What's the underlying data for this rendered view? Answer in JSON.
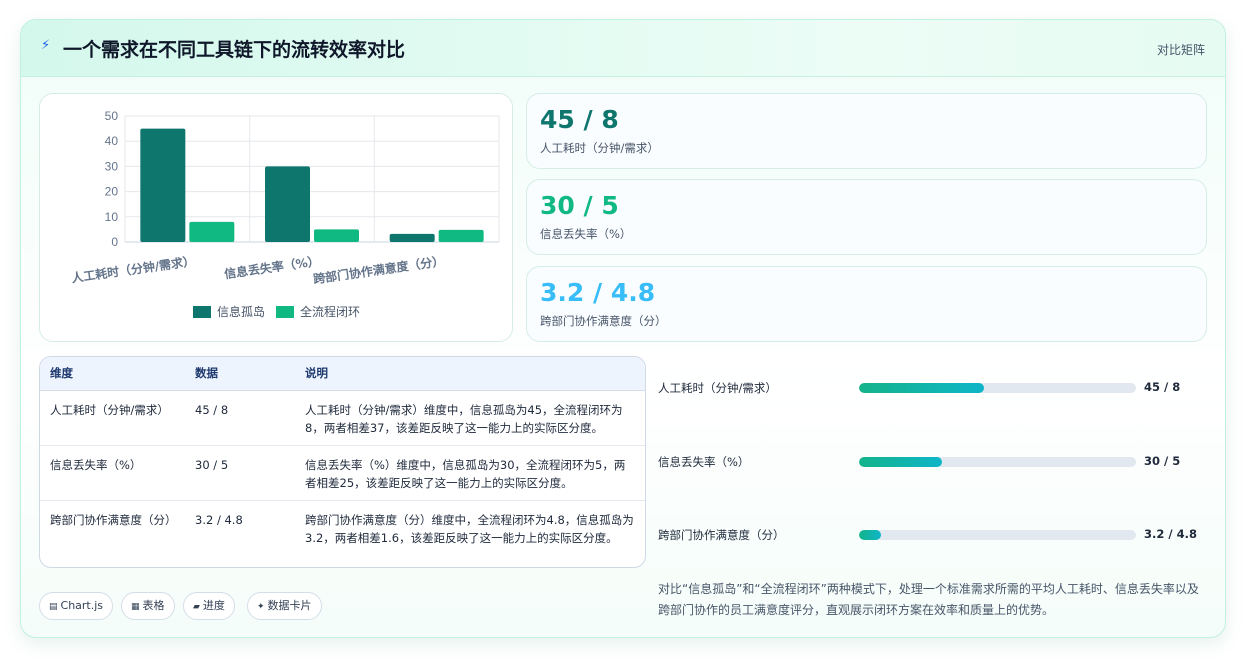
{
  "header": {
    "icon": "bolt-icon",
    "title": "一个需求在不同工具链下的流转效率对比",
    "tag": "对比矩阵"
  },
  "chart_data": {
    "type": "bar",
    "categories": [
      "人工耗时（分钟/需求）",
      "信息丢失率（%）",
      "跨部门协作满意度（分）"
    ],
    "series": [
      {
        "name": "信息孤岛",
        "values": [
          45,
          30,
          3.2
        ],
        "color": "#0f766e"
      },
      {
        "name": "全流程闭环",
        "values": [
          8,
          5,
          4.8
        ],
        "color": "#10b981"
      }
    ],
    "ylim": [
      0,
      50
    ],
    "yticks": [
      "0",
      "10",
      "20",
      "30",
      "40",
      "50"
    ],
    "grid": true,
    "legend_position": "bottom"
  },
  "stats": [
    {
      "value": "45 / 8",
      "label": "人工耗时（分钟/需求）",
      "color": "#0f766e"
    },
    {
      "value": "30 / 5",
      "label": "信息丢失率（%）",
      "color": "#10b981"
    },
    {
      "value": "3.2 / 4.8",
      "label": "跨部门协作满意度（分）",
      "color": "#38bdf8"
    }
  ],
  "table": {
    "headers": [
      "维度",
      "数据",
      "说明"
    ],
    "rows": [
      [
        "人工耗时（分钟/需求）",
        "45 / 8",
        "人工耗时（分钟/需求）维度中，信息孤岛为45，全流程闭环为8，两者相差37，该差距反映了这一能力上的实际区分度。"
      ],
      [
        "信息丢失率（%）",
        "30 / 5",
        "信息丢失率（%）维度中，信息孤岛为30，全流程闭环为5，两者相差25，该差距反映了这一能力上的实际区分度。"
      ],
      [
        "跨部门协作满意度（分）",
        "3.2 / 4.8",
        "跨部门协作满意度（分）维度中，全流程闭环为4.8，信息孤岛为3.2，两者相差1.6，该差距反映了这一能力上的实际区分度。"
      ]
    ]
  },
  "progress": [
    {
      "label": "人工耗时（分钟/需求）",
      "value": "45 / 8",
      "fill_fraction": 0.45
    },
    {
      "label": "信息丢失率（%）",
      "value": "30 / 5",
      "fill_fraction": 0.3
    },
    {
      "label": "跨部门协作满意度（分）",
      "value": "3.2 / 4.8",
      "fill_fraction": 0.08
    }
  ],
  "chips": [
    {
      "icon": "chart-icon",
      "glyph": "▤",
      "label": "Chart.js"
    },
    {
      "icon": "table-icon",
      "glyph": "▦",
      "label": "表格"
    },
    {
      "icon": "folder-icon",
      "glyph": "▰",
      "label": "进度"
    },
    {
      "icon": "sparkle-icon",
      "glyph": "✦",
      "label": "数据卡片"
    }
  ],
  "description": "对比“信息孤岛”和“全流程闭环”两种模式下，处理一个标准需求所需的平均人工耗时、信息丢失率以及跨部门协作的员工满意度评分，直观展示闭环方案在效率和质量上的优势。"
}
